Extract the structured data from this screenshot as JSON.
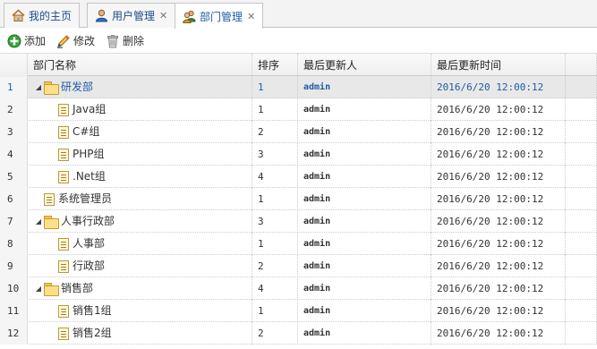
{
  "tabs": [
    {
      "label": "我的主页",
      "icon": "home-icon",
      "closable": false
    },
    {
      "label": "用户管理",
      "icon": "user-icon",
      "closable": true
    },
    {
      "label": "部门管理",
      "icon": "users-icon",
      "closable": true,
      "active": true
    }
  ],
  "toolbar": {
    "add_label": "添加",
    "edit_label": "修改",
    "delete_label": "删除"
  },
  "grid": {
    "columns": [
      "部门名称",
      "排序",
      "最后更新人",
      "最后更新时间"
    ],
    "rows": [
      {
        "num": "1",
        "name": "研发部",
        "sort": "1",
        "user": "admin",
        "time": "2016/6/20 12:00:12",
        "type": "folder",
        "level": 0,
        "expanded": true,
        "selected": true
      },
      {
        "num": "2",
        "name": "Java组",
        "sort": "1",
        "user": "admin",
        "time": "2016/6/20 12:00:12",
        "type": "file",
        "level": 1
      },
      {
        "num": "3",
        "name": "C#组",
        "sort": "2",
        "user": "admin",
        "time": "2016/6/20 12:00:12",
        "type": "file",
        "level": 1
      },
      {
        "num": "4",
        "name": "PHP组",
        "sort": "3",
        "user": "admin",
        "time": "2016/6/20 12:00:12",
        "type": "file",
        "level": 1
      },
      {
        "num": "5",
        "name": ".Net组",
        "sort": "4",
        "user": "admin",
        "time": "2016/6/20 12:00:12",
        "type": "file",
        "level": 1
      },
      {
        "num": "6",
        "name": "系统管理员",
        "sort": "1",
        "user": "admin",
        "time": "2016/6/20 12:00:12",
        "type": "file",
        "level": 0
      },
      {
        "num": "7",
        "name": "人事行政部",
        "sort": "3",
        "user": "admin",
        "time": "2016/6/20 12:00:12",
        "type": "folder",
        "level": 0,
        "expanded": true
      },
      {
        "num": "8",
        "name": "人事部",
        "sort": "1",
        "user": "admin",
        "time": "2016/6/20 12:00:12",
        "type": "file",
        "level": 1
      },
      {
        "num": "9",
        "name": "行政部",
        "sort": "2",
        "user": "admin",
        "time": "2016/6/20 12:00:12",
        "type": "file",
        "level": 1
      },
      {
        "num": "10",
        "name": "销售部",
        "sort": "4",
        "user": "admin",
        "time": "2016/6/20 12:00:12",
        "type": "folder",
        "level": 0,
        "expanded": true
      },
      {
        "num": "11",
        "name": "销售1组",
        "sort": "1",
        "user": "admin",
        "time": "2016/6/20 12:00:12",
        "type": "file",
        "level": 1
      },
      {
        "num": "12",
        "name": "销售2组",
        "sort": "2",
        "user": "admin",
        "time": "2016/6/20 12:00:12",
        "type": "file",
        "level": 1
      }
    ]
  }
}
